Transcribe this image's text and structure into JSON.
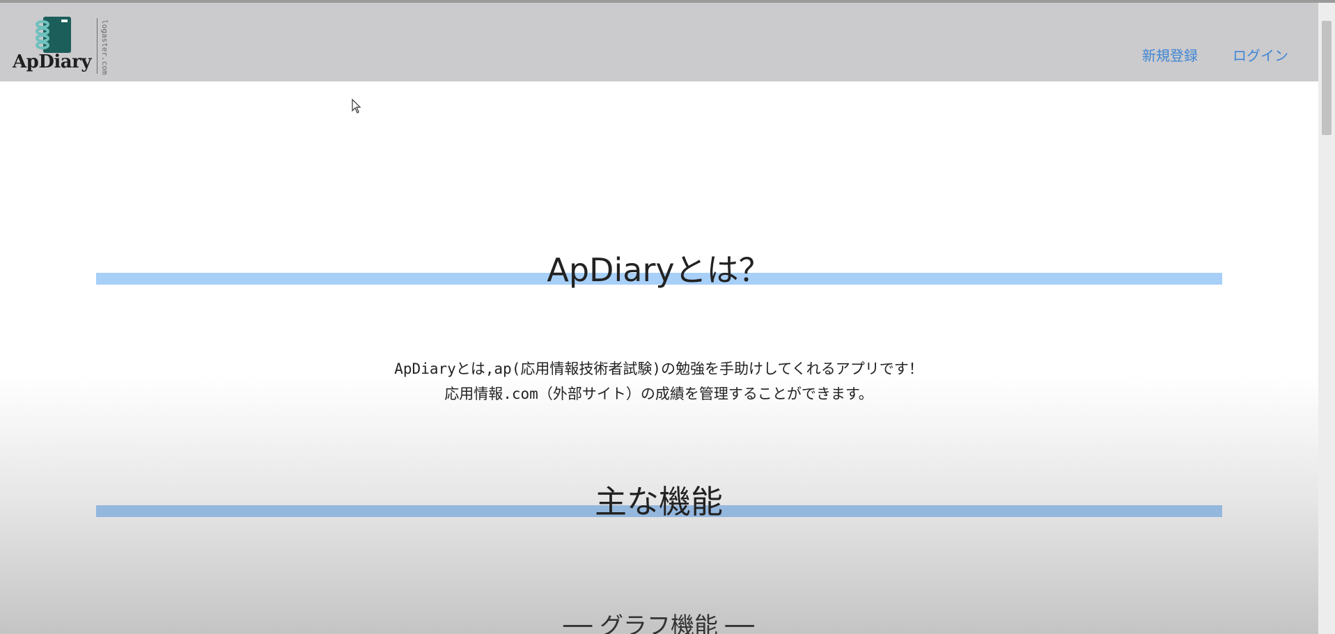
{
  "header": {
    "logo_text": "ApDiary",
    "logo_subtext": "logaster.com",
    "nav": {
      "register": "新規登録",
      "login": "ログイン"
    }
  },
  "main": {
    "section1_title": "ApDiaryとは？",
    "description_line1": "ApDiaryとは,ap(応用情報技術者試験)の勉強を手助けしてくれるアプリです！",
    "description_line2": "応用情報.com（外部サイト）の成績を管理することができます。",
    "section2_title": "主な機能",
    "feature_heading": "── グラフ機能 ──"
  },
  "colors": {
    "header_bg": "#cbcacd",
    "link": "#3f86d4",
    "bar1": "#a7cff8",
    "bar2": "#94b7dd",
    "logo_book": "#1b5e5a"
  },
  "icons": {
    "logo": "notebook-icon",
    "cursor": "mouse-cursor-icon"
  }
}
